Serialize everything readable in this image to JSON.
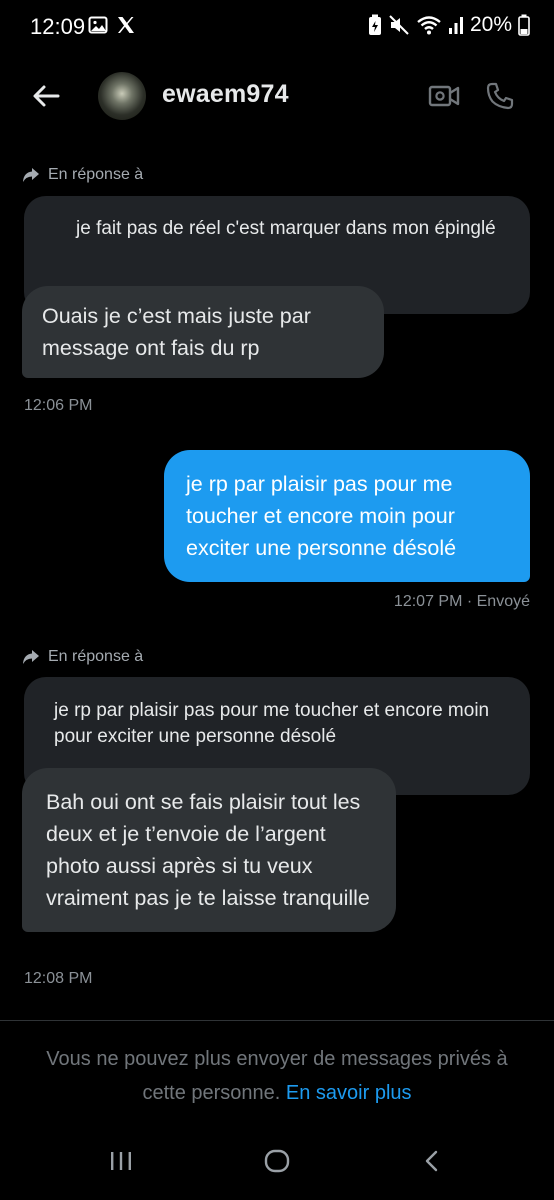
{
  "status_bar": {
    "time": "12:09",
    "battery": "20%",
    "icons": [
      "gallery-icon",
      "x-logo-icon",
      "battery-saver-icon",
      "mute-icon",
      "wifi-icon",
      "signal-icon",
      "battery-icon"
    ]
  },
  "header": {
    "username": "ewaem974",
    "icons": [
      "back-arrow-icon",
      "video-call-icon",
      "phone-icon"
    ]
  },
  "messages": [
    {
      "reply_label": "En réponse à",
      "quoted_text": "je fait pas de réel c'est marquer dans mon épinglé",
      "text": "Ouais je c’est mais juste par message ont fais du rp",
      "time": "12:06 PM"
    },
    {
      "text": "je rp par plaisir pas pour me toucher et encore moin pour exciter une personne désolé",
      "time": "12:07 PM · Envoyé"
    },
    {
      "reply_label": "En réponse à",
      "quoted_text": "je rp par plaisir pas pour me toucher et encore moin pour exciter une personne désolé",
      "text": "Bah oui ont se fais plaisir tout les deux et je t’envoie de l’argent photo aussi après si tu veux vraiment pas je te laisse tranquille",
      "time": "12:08 PM"
    }
  ],
  "footer": {
    "notice": "Vous ne pouvez plus envoyer de messages privés à cette personne.",
    "link": "En savoir plus"
  },
  "colors": {
    "background": "#000000",
    "incoming_bubble": "#2f3336",
    "quoted_bubble": "#202327",
    "outgoing_bubble": "#1d9bf0",
    "link": "#1d9bf0"
  }
}
